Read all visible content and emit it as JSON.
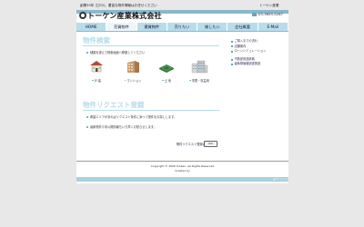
{
  "header": {
    "tagline": "創業35年 江戸川。豊富な物件情報はお任せください",
    "tagline_right": "トーケン産業",
    "company_name": "トーケン産業株式会社",
    "phone": "03-3655-5267"
  },
  "nav": {
    "items": [
      "HOME",
      "売買物件",
      "賃貸物件",
      "売りたい",
      "貸したい",
      "会社概要",
      "E-Mail"
    ],
    "active_index": 1
  },
  "search": {
    "title": "物件検索",
    "note": "種類を選んで検索画面へ移動してください",
    "properties": [
      {
        "label": "戸 建",
        "icon": "house-icon"
      },
      {
        "label": "マンション",
        "icon": "apartment-icon"
      },
      {
        "label": "土 地",
        "icon": "land-icon"
      },
      {
        "label": "事業・収益用",
        "icon": "office-building-icon"
      }
    ]
  },
  "sidebar": {
    "group1": [
      "ご購入までの流れ",
      "店舗案内",
      "ローンシミュレーション"
    ],
    "group2": [
      "不動産用語辞典",
      "建築物価格調査関連"
    ]
  },
  "request": {
    "title": "物件リクエスト登録",
    "notes": [
      "希望エリアがあればリクエスト条件に添って物件をお探しします。",
      "最新物件や非公開情報もいち早くお知らせします。"
    ],
    "link_text": "物件リクエスト登録はこちら",
    "go_label": "GO"
  },
  "footer": {
    "copyright": "Copyright © 2000 tohken .All Rights Reserved",
    "credit": "Created by",
    "bottom_note": "▲ページトップ"
  },
  "colors": {
    "accent": "#b9dce9",
    "title": "#b6dbe6",
    "bar": "#a9d0de"
  }
}
